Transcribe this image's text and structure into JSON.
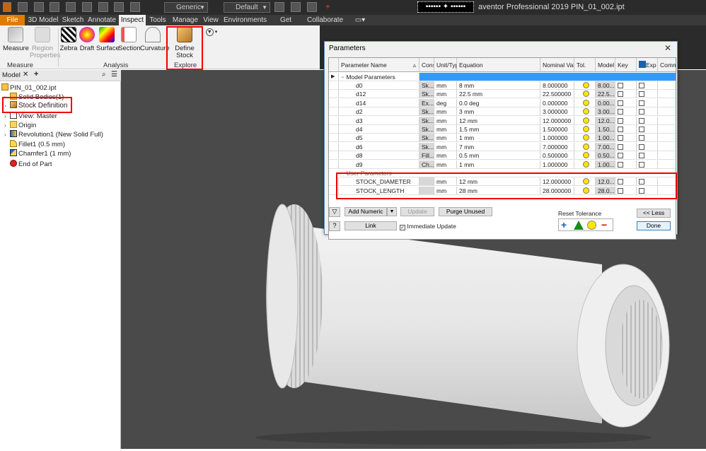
{
  "titlebar": {
    "app_title": "aventor Professional 2019   PIN_01_002.ipt",
    "material_combo": "Generic",
    "appearance_combo": "Default",
    "search_text": "▪▪▪▪▪▪ ✦ ▪▪▪▪▪▪"
  },
  "tabs": [
    "File",
    "3D Model",
    "Sketch",
    "Annotate",
    "Inspect",
    "Tools",
    "Manage",
    "View",
    "Environments",
    "Get Started",
    "Collaborate"
  ],
  "ribbon": {
    "measure": "Measure",
    "region_properties": "Region Properties",
    "zebra": "Zebra",
    "draft": "Draft",
    "surface": "Surface",
    "section": "Section",
    "curvature": "Curvature",
    "define_stock": "Define Stock",
    "panel_measure": "Measure",
    "panel_analysis": "Analysis",
    "panel_explore": "Explore"
  },
  "browser": {
    "tab_label": "Model",
    "items": [
      {
        "label": "PIN_01_002.ipt",
        "indent": 0,
        "icon": "part-icon"
      },
      {
        "label": "Solid Bodies(1)",
        "indent": 1,
        "icon": "solid-bodies-icon"
      },
      {
        "label": "Stock Definition",
        "indent": 1,
        "icon": "stock-icon"
      },
      {
        "label": "View: Master",
        "indent": 1,
        "icon": "view-icon"
      },
      {
        "label": "Origin",
        "indent": 1,
        "icon": "folder-icon"
      },
      {
        "label": "Revolution1 (New Solid Full)",
        "indent": 1,
        "icon": "revolve-icon"
      },
      {
        "label": "Fillet1 (0.5 mm)",
        "indent": 1,
        "icon": "fillet-icon"
      },
      {
        "label": "Chamfer1 (1 mm)",
        "indent": 1,
        "icon": "chamfer-icon"
      },
      {
        "label": "End of Part",
        "indent": 1,
        "icon": "end-of-part-icon"
      }
    ]
  },
  "dialog": {
    "title": "Parameters",
    "columns": [
      "Parameter Name",
      "Cons",
      "Unit/Type",
      "Equation",
      "Nominal Value",
      "Tol.",
      "Model V",
      "Key",
      "Exp",
      "Commen"
    ],
    "model_group": "Model Parameters",
    "user_group": "User Parameters",
    "model_rows": [
      {
        "name": "d0",
        "cons": "Sk...",
        "unit": "mm",
        "eq": "8 mm",
        "nom": "8.000000",
        "model": "8.00..."
      },
      {
        "name": "d12",
        "cons": "Sk...",
        "unit": "mm",
        "eq": "22.5 mm",
        "nom": "22.500000",
        "model": "22.5..."
      },
      {
        "name": "d14",
        "cons": "Ex...",
        "unit": "deg",
        "eq": "0.0 deg",
        "nom": "0.000000",
        "model": "0.00..."
      },
      {
        "name": "d2",
        "cons": "Sk...",
        "unit": "mm",
        "eq": "3 mm",
        "nom": "3.000000",
        "model": "3.00..."
      },
      {
        "name": "d3",
        "cons": "Sk...",
        "unit": "mm",
        "eq": "12 mm",
        "nom": "12.000000",
        "model": "12.0..."
      },
      {
        "name": "d4",
        "cons": "Sk...",
        "unit": "mm",
        "eq": "1.5 mm",
        "nom": "1.500000",
        "model": "1.50..."
      },
      {
        "name": "d5",
        "cons": "Sk...",
        "unit": "mm",
        "eq": "1 mm",
        "nom": "1.000000",
        "model": "1.00..."
      },
      {
        "name": "d6",
        "cons": "Sk...",
        "unit": "mm",
        "eq": "7 mm",
        "nom": "7.000000",
        "model": "7.00..."
      },
      {
        "name": "d8",
        "cons": "Fill...",
        "unit": "mm",
        "eq": "0.5 mm",
        "nom": "0.500000",
        "model": "0.50..."
      },
      {
        "name": "d9",
        "cons": "Ch...",
        "unit": "mm",
        "eq": "1 mm",
        "nom": "1.000000",
        "model": "1.00..."
      }
    ],
    "user_rows": [
      {
        "name": "STOCK_DIAMETER",
        "cons": "",
        "unit": "mm",
        "eq": "12 mm",
        "nom": "12.000000",
        "model": "12.0..."
      },
      {
        "name": "STOCK_LENGTH",
        "cons": "",
        "unit": "mm",
        "eq": "28 mm",
        "nom": "28.000000",
        "model": "28.0..."
      }
    ],
    "buttons": {
      "add_numeric": "Add Numeric",
      "update": "Update",
      "purge_unused": "Purge Unused",
      "link": "Link",
      "immediate_update": "Immediate Update",
      "reset_tolerance": "Reset Tolerance",
      "less": "<< Less",
      "done": "Done"
    }
  },
  "colors": {
    "file_tab": "#e07b00",
    "highlight_red": "#e00000",
    "selection_blue": "#3399ff",
    "tol_yellow": "#ffe600",
    "viewport_bg": "#4a4a4a"
  }
}
